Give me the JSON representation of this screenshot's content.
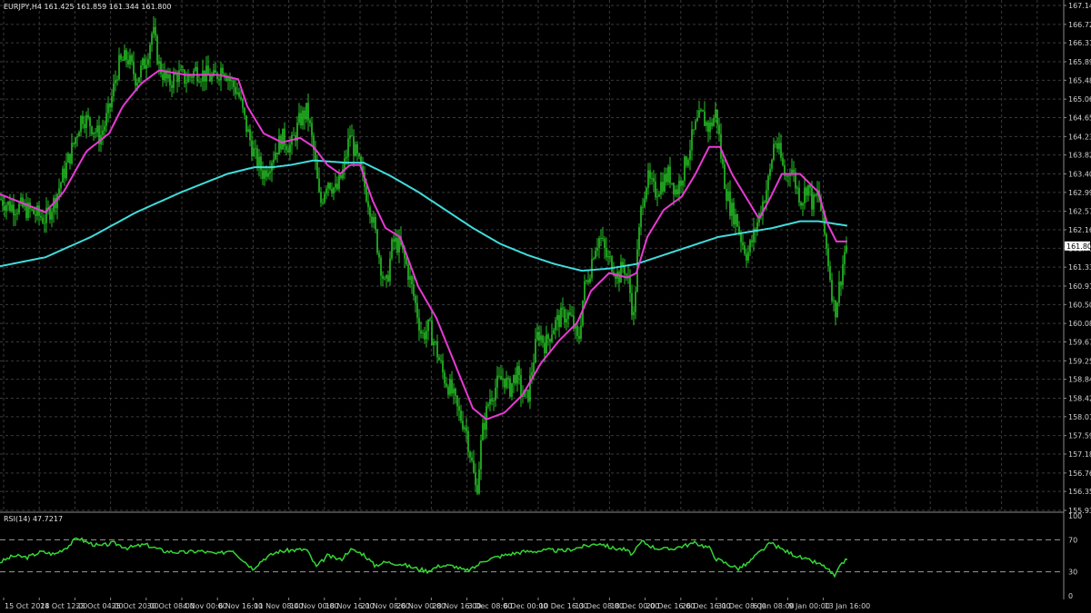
{
  "main_chart": {
    "title": "EURJPY,H4  161.425 161.859 161.344 161.800",
    "current_price": "161.800",
    "y_ticks": [
      "167.140",
      "166.720",
      "166.310",
      "165.890",
      "165.480",
      "165.060",
      "164.650",
      "164.230",
      "163.820",
      "163.400",
      "162.990",
      "162.570",
      "162.160",
      "161.750",
      "161.330",
      "160.910",
      "160.500",
      "160.080",
      "159.670",
      "159.250",
      "158.840",
      "158.420",
      "158.010",
      "157.590",
      "157.180",
      "156.760",
      "156.350",
      "155.930"
    ],
    "colors": {
      "candles": "#26c226",
      "fast_ma": "#e83ad4",
      "slow_ma": "#40dcdc",
      "grid": "#3a3a3a",
      "background": "#000000",
      "text": "#d0d0d0"
    }
  },
  "rsi_panel": {
    "title": "RSI(14) 47.7217",
    "y_ticks": [
      "100",
      "70",
      "30",
      "0"
    ],
    "levels": [
      70,
      30
    ],
    "color": "#35d535"
  },
  "x_axis": {
    "labels": [
      "15 Oct 2024",
      "18 Oct 12:00",
      "23 Oct 04:00",
      "25 Oct 20:00",
      "30 Oct 08:00",
      "4 Nov 00:00",
      "6 Nov 16:00",
      "11 Nov 08:00",
      "14 Nov 00:00",
      "18 Nov 16:00",
      "21 Nov 08:00",
      "26 Nov 00:00",
      "28 Nov 16:00",
      "3 Dec 08:00",
      "6 Dec 00:00",
      "10 Dec 16:00",
      "13 Dec 08:00",
      "18 Dec 00:00",
      "20 Dec 16:00",
      "26 Dec 16:00",
      "31 Dec 08:00",
      "6 Jan 08:00",
      "9 Jan 00:00",
      "13 Jan 16:00"
    ]
  },
  "chart_data": {
    "type": "candlestick",
    "symbol": "EURJPY",
    "timeframe": "H4",
    "ylim": [
      155.93,
      167.14
    ],
    "price_keypoints": [
      [
        0,
        162.85
      ],
      [
        10,
        162.7
      ],
      [
        25,
        162.65
      ],
      [
        35,
        162.55
      ],
      [
        50,
        162.4
      ],
      [
        60,
        162.8
      ],
      [
        70,
        163.4
      ],
      [
        80,
        164.0
      ],
      [
        90,
        164.7
      ],
      [
        100,
        164.5
      ],
      [
        110,
        164.2
      ],
      [
        120,
        164.8
      ],
      [
        130,
        165.8
      ],
      [
        140,
        166.0
      ],
      [
        150,
        165.5
      ],
      [
        160,
        165.9
      ],
      [
        168,
        166.6
      ],
      [
        175,
        165.8
      ],
      [
        185,
        165.4
      ],
      [
        195,
        165.6
      ],
      [
        205,
        165.5
      ],
      [
        215,
        165.7
      ],
      [
        225,
        165.6
      ],
      [
        235,
        165.5
      ],
      [
        245,
        165.8
      ],
      [
        255,
        165.4
      ],
      [
        262,
        165.2
      ],
      [
        270,
        164.5
      ],
      [
        280,
        163.8
      ],
      [
        290,
        163.4
      ],
      [
        300,
        163.8
      ],
      [
        310,
        164.2
      ],
      [
        320,
        164.0
      ],
      [
        330,
        164.6
      ],
      [
        338,
        164.8
      ],
      [
        345,
        163.9
      ],
      [
        352,
        162.7
      ],
      [
        360,
        163.3
      ],
      [
        370,
        163.0
      ],
      [
        378,
        163.5
      ],
      [
        385,
        164.3
      ],
      [
        390,
        163.9
      ],
      [
        395,
        163.6
      ],
      [
        400,
        163.2
      ],
      [
        408,
        162.6
      ],
      [
        416,
        161.7
      ],
      [
        424,
        160.8
      ],
      [
        432,
        161.9
      ],
      [
        440,
        161.8
      ],
      [
        448,
        161.3
      ],
      [
        456,
        160.6
      ],
      [
        464,
        159.8
      ],
      [
        472,
        160.0
      ],
      [
        480,
        159.5
      ],
      [
        488,
        158.9
      ],
      [
        496,
        158.6
      ],
      [
        504,
        158.1
      ],
      [
        512,
        157.8
      ],
      [
        518,
        157.1
      ],
      [
        524,
        156.3
      ],
      [
        530,
        157.6
      ],
      [
        538,
        158.4
      ],
      [
        546,
        158.7
      ],
      [
        554,
        158.9
      ],
      [
        560,
        158.6
      ],
      [
        568,
        159.0
      ],
      [
        574,
        158.5
      ],
      [
        580,
        158.4
      ],
      [
        586,
        159.2
      ],
      [
        592,
        159.9
      ],
      [
        600,
        159.6
      ],
      [
        608,
        160.0
      ],
      [
        616,
        160.2
      ],
      [
        624,
        160.3
      ],
      [
        630,
        160.1
      ],
      [
        636,
        159.6
      ],
      [
        642,
        160.8
      ],
      [
        648,
        161.2
      ],
      [
        654,
        161.8
      ],
      [
        660,
        162.0
      ],
      [
        668,
        161.5
      ],
      [
        674,
        161.4
      ],
      [
        680,
        161.1
      ],
      [
        686,
        161.4
      ],
      [
        692,
        160.9
      ],
      [
        697,
        160.2
      ],
      [
        701,
        161.6
      ],
      [
        706,
        162.8
      ],
      [
        712,
        163.3
      ],
      [
        720,
        163.0
      ],
      [
        728,
        163.2
      ],
      [
        736,
        163.4
      ],
      [
        744,
        163.0
      ],
      [
        752,
        163.5
      ],
      [
        760,
        164.1
      ],
      [
        766,
        164.5
      ],
      [
        772,
        164.7
      ],
      [
        780,
        164.4
      ],
      [
        788,
        164.8
      ],
      [
        793,
        163.8
      ],
      [
        798,
        163.1
      ],
      [
        804,
        162.6
      ],
      [
        810,
        162.4
      ],
      [
        816,
        161.9
      ],
      [
        822,
        161.6
      ],
      [
        830,
        162.1
      ],
      [
        838,
        162.7
      ],
      [
        846,
        163.3
      ],
      [
        852,
        164.2
      ],
      [
        858,
        163.8
      ],
      [
        864,
        163.3
      ],
      [
        870,
        163.6
      ],
      [
        876,
        163.1
      ],
      [
        882,
        162.8
      ],
      [
        888,
        163.2
      ],
      [
        894,
        162.7
      ],
      [
        900,
        163.0
      ],
      [
        906,
        162.2
      ],
      [
        912,
        161.3
      ],
      [
        918,
        160.3
      ],
      [
        924,
        161.0
      ],
      [
        930,
        161.8
      ]
    ],
    "fast_ma_keypoints": [
      [
        0,
        162.95
      ],
      [
        25,
        162.75
      ],
      [
        50,
        162.55
      ],
      [
        70,
        163.0
      ],
      [
        95,
        163.9
      ],
      [
        120,
        164.3
      ],
      [
        135,
        164.9
      ],
      [
        155,
        165.4
      ],
      [
        175,
        165.7
      ],
      [
        205,
        165.6
      ],
      [
        240,
        165.6
      ],
      [
        262,
        165.5
      ],
      [
        272,
        164.9
      ],
      [
        290,
        164.3
      ],
      [
        310,
        164.1
      ],
      [
        330,
        164.2
      ],
      [
        345,
        164.0
      ],
      [
        360,
        163.6
      ],
      [
        374,
        163.4
      ],
      [
        385,
        163.6
      ],
      [
        396,
        163.6
      ],
      [
        410,
        162.8
      ],
      [
        424,
        162.2
      ],
      [
        440,
        162.0
      ],
      [
        460,
        160.9
      ],
      [
        480,
        160.2
      ],
      [
        500,
        159.2
      ],
      [
        520,
        158.2
      ],
      [
        535,
        157.95
      ],
      [
        555,
        158.1
      ],
      [
        575,
        158.5
      ],
      [
        595,
        159.2
      ],
      [
        615,
        159.7
      ],
      [
        635,
        160.1
      ],
      [
        650,
        160.8
      ],
      [
        670,
        161.2
      ],
      [
        690,
        161.1
      ],
      [
        700,
        161.2
      ],
      [
        712,
        162.0
      ],
      [
        730,
        162.6
      ],
      [
        750,
        162.9
      ],
      [
        765,
        163.4
      ],
      [
        780,
        164.0
      ],
      [
        792,
        164.0
      ],
      [
        805,
        163.4
      ],
      [
        820,
        162.9
      ],
      [
        835,
        162.4
      ],
      [
        848,
        162.9
      ],
      [
        860,
        163.4
      ],
      [
        880,
        163.4
      ],
      [
        900,
        163.0
      ],
      [
        910,
        162.3
      ],
      [
        920,
        161.9
      ],
      [
        932,
        161.9
      ]
    ],
    "slow_ma_keypoints": [
      [
        0,
        161.35
      ],
      [
        50,
        161.55
      ],
      [
        100,
        162.0
      ],
      [
        150,
        162.55
      ],
      [
        200,
        163.0
      ],
      [
        250,
        163.4
      ],
      [
        280,
        163.55
      ],
      [
        300,
        163.55
      ],
      [
        320,
        163.6
      ],
      [
        345,
        163.7
      ],
      [
        380,
        163.65
      ],
      [
        400,
        163.65
      ],
      [
        430,
        163.35
      ],
      [
        460,
        163.0
      ],
      [
        490,
        162.6
      ],
      [
        520,
        162.2
      ],
      [
        550,
        161.85
      ],
      [
        580,
        161.6
      ],
      [
        610,
        161.4
      ],
      [
        640,
        161.25
      ],
      [
        670,
        161.3
      ],
      [
        700,
        161.4
      ],
      [
        730,
        161.6
      ],
      [
        760,
        161.8
      ],
      [
        790,
        162.0
      ],
      [
        820,
        162.1
      ],
      [
        850,
        162.2
      ],
      [
        880,
        162.35
      ],
      [
        900,
        162.35
      ],
      [
        932,
        162.25
      ]
    ],
    "rsi_keypoints": [
      [
        0,
        42
      ],
      [
        15,
        50
      ],
      [
        30,
        48
      ],
      [
        45,
        55
      ],
      [
        60,
        52
      ],
      [
        75,
        62
      ],
      [
        85,
        73
      ],
      [
        95,
        67
      ],
      [
        110,
        62
      ],
      [
        125,
        66
      ],
      [
        140,
        60
      ],
      [
        160,
        64
      ],
      [
        180,
        56
      ],
      [
        200,
        54
      ],
      [
        220,
        56
      ],
      [
        240,
        52
      ],
      [
        255,
        58
      ],
      [
        268,
        44
      ],
      [
        278,
        34
      ],
      [
        290,
        46
      ],
      [
        305,
        55
      ],
      [
        320,
        57
      ],
      [
        337,
        58
      ],
      [
        348,
        36
      ],
      [
        360,
        50
      ],
      [
        375,
        45
      ],
      [
        385,
        58
      ],
      [
        400,
        52
      ],
      [
        412,
        38
      ],
      [
        424,
        42
      ],
      [
        440,
        40
      ],
      [
        455,
        35
      ],
      [
        470,
        31
      ],
      [
        485,
        38
      ],
      [
        500,
        37
      ],
      [
        512,
        31
      ],
      [
        520,
        34
      ],
      [
        532,
        44
      ],
      [
        545,
        48
      ],
      [
        560,
        52
      ],
      [
        575,
        55
      ],
      [
        590,
        56
      ],
      [
        605,
        57
      ],
      [
        620,
        56
      ],
      [
        635,
        60
      ],
      [
        648,
        63
      ],
      [
        660,
        66
      ],
      [
        672,
        60
      ],
      [
        686,
        58
      ],
      [
        696,
        52
      ],
      [
        706,
        68
      ],
      [
        720,
        60
      ],
      [
        735,
        58
      ],
      [
        750,
        62
      ],
      [
        765,
        66
      ],
      [
        780,
        60
      ],
      [
        788,
        46
      ],
      [
        800,
        40
      ],
      [
        812,
        34
      ],
      [
        822,
        40
      ],
      [
        835,
        54
      ],
      [
        848,
        66
      ],
      [
        860,
        58
      ],
      [
        872,
        52
      ],
      [
        884,
        46
      ],
      [
        896,
        42
      ],
      [
        908,
        36
      ],
      [
        918,
        24
      ],
      [
        925,
        38
      ],
      [
        932,
        47.7
      ]
    ]
  }
}
